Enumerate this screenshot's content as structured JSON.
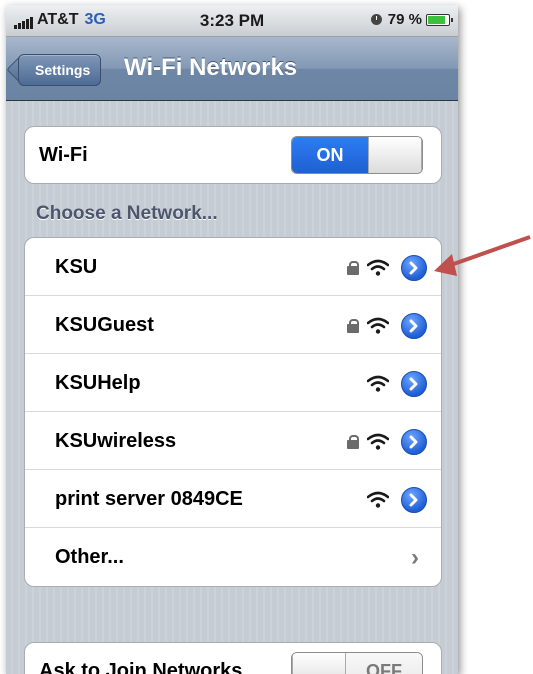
{
  "status_bar": {
    "carrier": "AT&T",
    "network": "3G",
    "time": "3:23 PM",
    "battery": "79 %",
    "battery_level": 0.79
  },
  "nav": {
    "back_label": "Settings",
    "title": "Wi-Fi Networks"
  },
  "wifi_toggle": {
    "label": "Wi-Fi",
    "state": "ON"
  },
  "section_header": "Choose a Network...",
  "networks": [
    {
      "name": "KSU",
      "secured": true
    },
    {
      "name": "KSUGuest",
      "secured": true
    },
    {
      "name": "KSUHelp",
      "secured": false
    },
    {
      "name": "KSUwireless",
      "secured": true
    },
    {
      "name": "print server 0849CE",
      "secured": false
    }
  ],
  "other_label": "Other...",
  "ask_to_join": {
    "label": "Ask to Join Networks",
    "state": "OFF"
  },
  "colors": {
    "accent": "#1e61d2",
    "annotation_arrow": "#c0504d"
  }
}
